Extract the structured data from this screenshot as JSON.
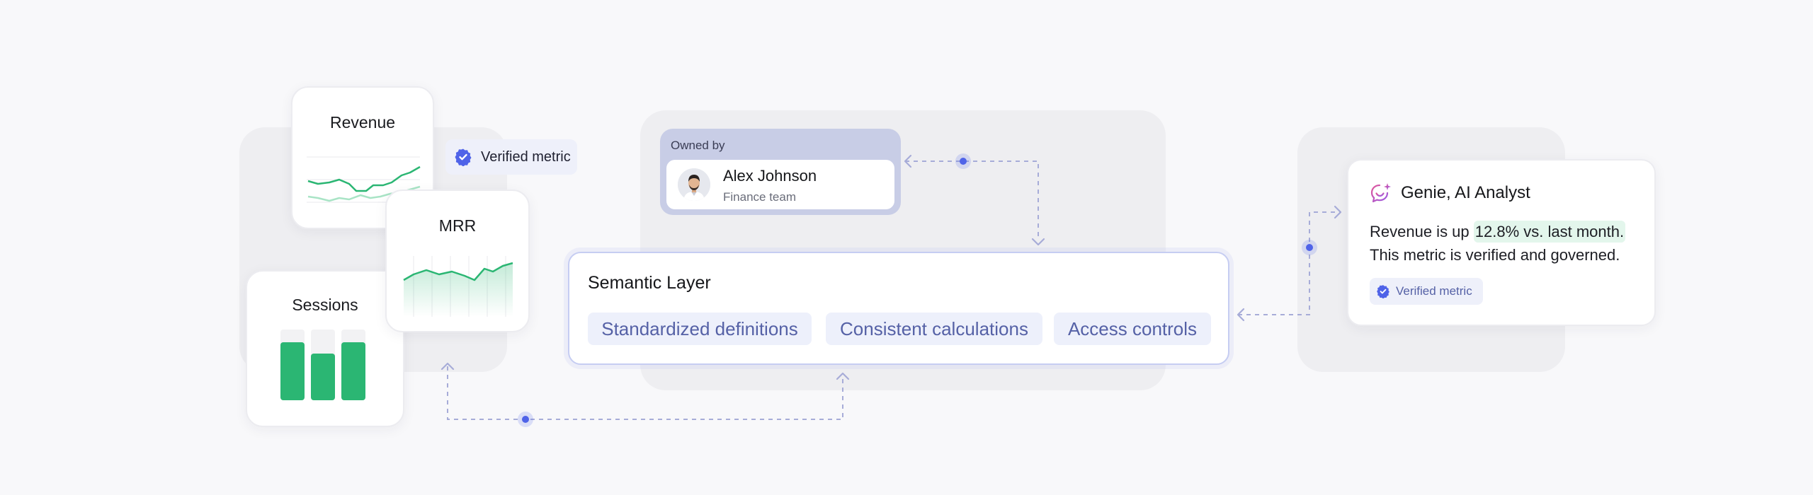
{
  "cards": {
    "revenue": {
      "title": "Revenue"
    },
    "mrr": {
      "title": "MRR"
    },
    "sessions": {
      "title": "Sessions",
      "bars": [
        0.82,
        0.66,
        0.82
      ]
    }
  },
  "verified_pill": {
    "label": "Verified metric",
    "icon": "check-badge-icon"
  },
  "owner": {
    "caption": "Owned by",
    "name": "Alex Johnson",
    "team": "Finance team",
    "icon": "avatar-icon"
  },
  "semantic_layer": {
    "title": "Semantic Layer",
    "chips": [
      "Standardized definitions",
      "Consistent calculations",
      "Access controls"
    ]
  },
  "genie": {
    "title": "Genie, AI Analyst",
    "icon": "sparkle-chat-icon",
    "message_prefix": "Revenue is up ",
    "message_highlight": "12.8% vs. last month.",
    "message_line2": "This metric is verified and governed.",
    "badge": "Verified metric"
  },
  "colors": {
    "accent": "#5561a6",
    "green": "#2bb673",
    "connector": "#a7acd8",
    "node": "#4f63e8"
  }
}
